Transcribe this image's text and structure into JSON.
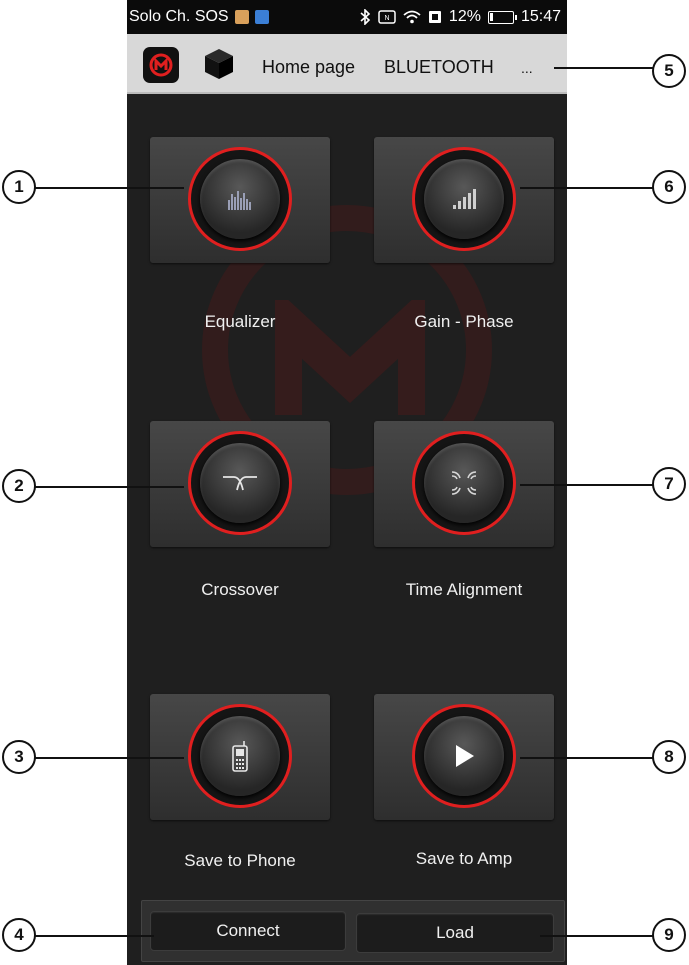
{
  "status_bar": {
    "carrier": "Solo Ch. SOS",
    "battery_percent": "12%",
    "time": "15:47"
  },
  "toolbar": {
    "home_label": "Home page",
    "bluetooth_label": "BLUETOOTH",
    "more_label": "..."
  },
  "tiles": {
    "equalizer": "Equalizer",
    "gain_phase": "Gain - Phase",
    "crossover": "Crossover",
    "time_alignment": "Time Alignment",
    "save_phone": "Save to Phone",
    "save_amp": "Save to Amp"
  },
  "buttons": {
    "connect": "Connect",
    "load": "Load"
  },
  "callouts": [
    "1",
    "2",
    "3",
    "4",
    "5",
    "6",
    "7",
    "8",
    "9"
  ],
  "colors": {
    "accent": "#e01f1f",
    "background": "#1f1f1f",
    "toolbar": "#d8d8d8"
  },
  "icons": [
    "equalizer-bars-icon",
    "signal-strength-icon",
    "crossover-curve-icon",
    "time-alignment-icon",
    "phone-icon",
    "play-icon",
    "app-logo-icon",
    "cube-icon"
  ]
}
